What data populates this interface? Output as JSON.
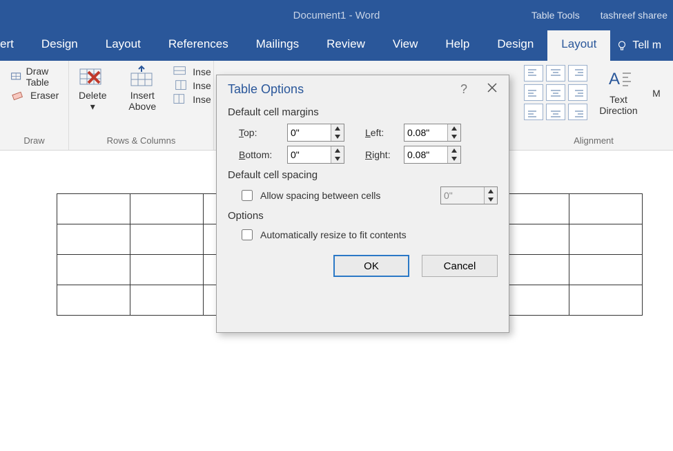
{
  "titlebar": {
    "document": "Document1",
    "sep": " - ",
    "app": "Word",
    "context": "Table Tools",
    "user": "tashreef sharee"
  },
  "tabs": {
    "t0": "ert",
    "t1": "Design",
    "t2": "Layout",
    "t3": "References",
    "t4": "Mailings",
    "t5": "Review",
    "t6": "View",
    "t7": "Help",
    "t8": "Design",
    "t9": "Layout",
    "tell": "Tell m"
  },
  "ribbon": {
    "draw_table": "Draw Table",
    "eraser": "Eraser",
    "draw_group": "Draw",
    "delete": "Delete",
    "insert_above": "Insert\nAbove",
    "insert_below": "Insert Below",
    "insert_left": "Insert Left",
    "insert_right": "Insert Right",
    "rows_cols_group": "Rows & Columns",
    "ins_cut1": "Inse",
    "ins_cut2": "Inse",
    "ins_cut3": "Inse",
    "text_dir": "Text\nDirection",
    "align_group": "Alignment",
    "m_cut": "M"
  },
  "dialog": {
    "title": "Table Options",
    "section_margins": "Default cell margins",
    "top_label": "Top:",
    "top_value": "0\"",
    "left_label": "Left:",
    "left_value": "0.08\"",
    "bottom_label": "Bottom:",
    "bottom_value": "0\"",
    "right_label": "Right:",
    "right_value": "0.08\"",
    "section_spacing": "Default cell spacing",
    "allow_spacing": "Allow spacing between cells",
    "spacing_value": "0\"",
    "section_options": "Options",
    "auto_resize": "Automatically resize to fit contents",
    "ok": "OK",
    "cancel": "Cancel"
  }
}
